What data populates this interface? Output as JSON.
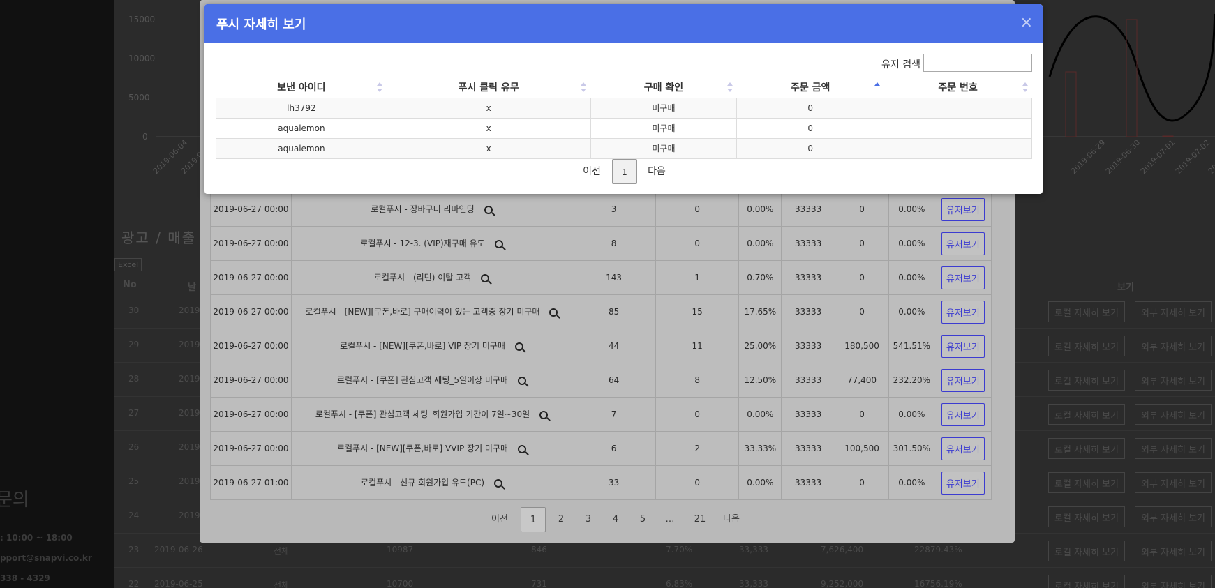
{
  "background": {
    "sidebar": {
      "contact_title": "문의",
      "lines": [
        ": 10:00 ~ 18:00",
        "pport@snapvi.co.kr",
        "338 - 4329"
      ]
    },
    "chart": {
      "y_ticks": [
        "15000",
        "10000",
        "5000",
        "0"
      ],
      "x_ticks": [
        "2019-06-04",
        "2019-0",
        "2019-06-29",
        "2019-06-30",
        "2019-07-01",
        "2019-07-02",
        "2019-07-03"
      ]
    },
    "section_title": "광고 / 매출",
    "excel_label": "Excel",
    "table_headers": {
      "no": "No",
      "date": "날",
      "view": "보기"
    },
    "rows": [
      {
        "no": "30",
        "date": "2019"
      },
      {
        "no": "29",
        "date": "2019"
      },
      {
        "no": "28",
        "date": "2019"
      },
      {
        "no": "27",
        "date": "2019"
      },
      {
        "no": "26",
        "date": "2019"
      },
      {
        "no": "25",
        "date": "2019"
      },
      {
        "no": "24",
        "date": "2019"
      },
      {
        "no": "23",
        "date": "2019-06-26",
        "type": "전체",
        "a": "10987",
        "b": "846",
        "c": "7.70%",
        "d": "33,333",
        "e": "7,626,400",
        "f": "22879.43%"
      },
      {
        "no": "22",
        "date": "2019-06-25",
        "type": "전체",
        "a": "10700",
        "b": "731",
        "c": "6.83%",
        "d": "33,333",
        "e": "9,252,000",
        "f": "16756.19%"
      }
    ],
    "local_detail_label": "로컬 자세히 보기",
    "external_detail_label": "외부 자세히 보기"
  },
  "under_modal": {
    "rows": [
      {
        "date": "2019-06-27 00:00",
        "title": "로컬푸시 - 장바구니 리마인딩",
        "sent": "3",
        "clicks": "0",
        "ctr": "0.00%",
        "cost": "33333",
        "sales": "0",
        "roas": "0.00%",
        "btn": "유저보기"
      },
      {
        "date": "2019-06-27 00:00",
        "title": "로컬푸시 - 12-3. (VIP)재구매 유도",
        "sent": "8",
        "clicks": "0",
        "ctr": "0.00%",
        "cost": "33333",
        "sales": "0",
        "roas": "0.00%",
        "btn": "유저보기"
      },
      {
        "date": "2019-06-27 00:00",
        "title": "로컬푸시 - (리턴) 이탈 고객",
        "sent": "143",
        "clicks": "1",
        "ctr": "0.70%",
        "cost": "33333",
        "sales": "0",
        "roas": "0.00%",
        "btn": "유저보기"
      },
      {
        "date": "2019-06-27 00:00",
        "title": "로컬푸시 - [NEW][쿠폰,바로] 구매이력이 있는 고객중 장기 미구매",
        "sent": "85",
        "clicks": "15",
        "ctr": "17.65%",
        "cost": "33333",
        "sales": "0",
        "roas": "0.00%",
        "btn": "유저보기"
      },
      {
        "date": "2019-06-27 00:00",
        "title": "로컬푸시 - [NEW][쿠폰,바로] VIP 장기 미구매",
        "sent": "44",
        "clicks": "11",
        "ctr": "25.00%",
        "cost": "33333",
        "sales": "180,500",
        "roas": "541.51%",
        "btn": "유저보기"
      },
      {
        "date": "2019-06-27 00:00",
        "title": "로컬푸시 - [쿠폰] 관심고객 세팅_5일이상 미구매",
        "sent": "64",
        "clicks": "8",
        "ctr": "12.50%",
        "cost": "33333",
        "sales": "77,400",
        "roas": "232.20%",
        "btn": "유저보기"
      },
      {
        "date": "2019-06-27 00:00",
        "title": "로컬푸시 - [쿠폰] 관심고객 세팅_회원가입 기간이 7일~30일",
        "sent": "7",
        "clicks": "0",
        "ctr": "0.00%",
        "cost": "33333",
        "sales": "0",
        "roas": "0.00%",
        "btn": "유저보기"
      },
      {
        "date": "2019-06-27 00:00",
        "title": "로컬푸시 - [NEW][쿠폰,바로] VVIP 장기 미구매",
        "sent": "6",
        "clicks": "2",
        "ctr": "33.33%",
        "cost": "33333",
        "sales": "100,500",
        "roas": "301.50%",
        "btn": "유저보기"
      },
      {
        "date": "2019-06-27 01:00",
        "title": "로컬푸시 - 신규 회원가입 유도(PC)",
        "sent": "33",
        "clicks": "0",
        "ctr": "0.00%",
        "cost": "33333",
        "sales": "0",
        "roas": "0.00%",
        "btn": "유저보기"
      }
    ],
    "pager": {
      "prev": "이전",
      "pages": [
        "1",
        "2",
        "3",
        "4",
        "5",
        "…",
        "21"
      ],
      "next": "다음"
    }
  },
  "modal": {
    "title": "푸시 자세히 보기",
    "close": "×",
    "search_label": "유저 검색",
    "search_value": "",
    "columns": [
      "보낸 아이디",
      "푸시 클릭 유무",
      "구매 확인",
      "주문 금액",
      "주문 번호"
    ],
    "rows": [
      {
        "id": "lh3792",
        "clicked": "x",
        "purchase": "미구매",
        "amount": "0",
        "order_no": ""
      },
      {
        "id": "aqualemon",
        "clicked": "x",
        "purchase": "미구매",
        "amount": "0",
        "order_no": ""
      },
      {
        "id": "aqualemon",
        "clicked": "x",
        "purchase": "미구매",
        "amount": "0",
        "order_no": ""
      }
    ],
    "pager": {
      "prev": "이전",
      "page": "1",
      "next": "다음"
    }
  }
}
